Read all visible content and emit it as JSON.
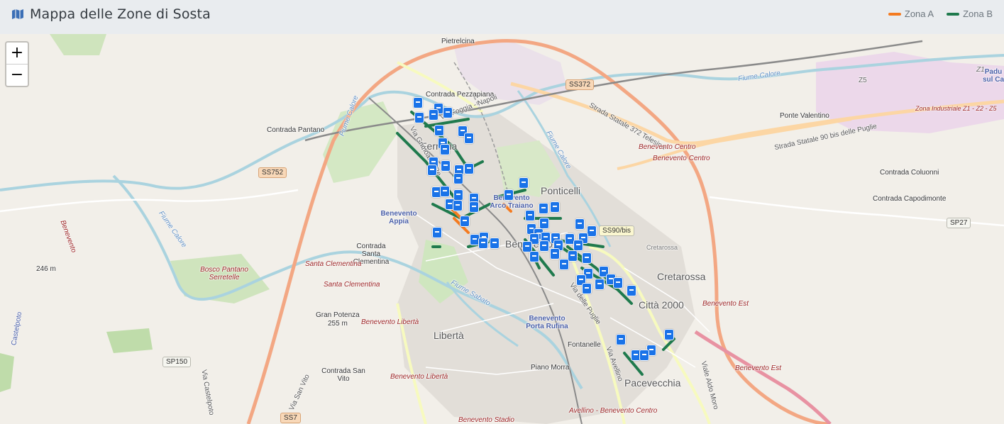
{
  "header": {
    "title": "Mappa delle Zone di Sosta",
    "icon": "map-icon"
  },
  "legend": [
    {
      "label": "Zona A",
      "color": "#f47b20"
    },
    {
      "label": "Zona B",
      "color": "#1f7a4d"
    }
  ],
  "zoom": {
    "in_label": "+",
    "out_label": "−"
  },
  "map": {
    "places": {
      "pietrelcina": "Pietrelcina",
      "contrada_pezzapiana": "Contrada Pezzapiana",
      "contrada_pantano": "Contrada Pantano",
      "ferrovia": "Ferrovia",
      "ponticelli": "Ponticelli",
      "benevento": "Benevento",
      "rione_libert": "Libertà",
      "cretarossa": "Cretarossa",
      "citta_2000": "Città 2000",
      "pacevecchia": "Pacevecchia",
      "ponte_valentino": "Ponte Valentino",
      "contrada_coluonni": "Contrada Coluonni",
      "contrada_capodimonte": "Contrada Capodimonte",
      "contrada_santa_clementina": "Contrada Santa Clementina",
      "contrada_san_vito": "Contrada San Vito",
      "gran_potenza": "Gran Potenza",
      "gran_potenza_elev": "255 m",
      "elev_246": "246 m",
      "bosco_pantano": "Bosco Pantano Serretelle",
      "fontanelle": "Fontanelle",
      "piano_morra": "Piano Morra",
      "cretarossa_small": "Cretarossa",
      "z5": "Z5",
      "z1": "Z1",
      "padu": "Padu sul Ca",
      "via_grimoaldo": "Via Grimoaldo Re",
      "via_puglie": "Via delle Puglie",
      "via_avellino": "Via Avellino",
      "via_aldo_moro": "Viale Aldo Moro",
      "via_san_vito": "Via San Vito",
      "via_castelpoto": "Via Castelpoto",
      "castelpoto": "Castelpoto",
      "benevento_label": "Benevento",
      "fiume_calore_1": "Fiume Calore",
      "fiume_calore_2": "Fiume Calore",
      "fiume_calore_3": "Fiume Calore",
      "fiume_calore_4": "Fiume Calore",
      "fiume_sabato": "Fiume Sabato",
      "via_foggia_napoli": "Via Foggia - Napoli",
      "strada_372": "Strada Statale 372 Telesina",
      "strada_90bis": "Strada Statale 90 bis delle Puglie",
      "zona_industriale": "Zona Industriale Z1 - Z2 - Z5"
    },
    "stations": {
      "appia": "Benevento Appia",
      "arco_traiano": "Benevento Arco Traiano",
      "porta_rufina": "Benevento Porta Rufina"
    },
    "rail_labels": {
      "benevento_centro_1": "Benevento Centro",
      "benevento_centro_2": "Benevento Centro",
      "santa_clementina_1": "Santa Clementina",
      "santa_clementina_2": "Santa Clementina",
      "benevento_liberta_1": "Benevento Libertà",
      "benevento_liberta_2": "Benevento Libertà",
      "benevento_est_1": "Benevento Est",
      "benevento_est_2": "Benevento Est",
      "avellino_benevento": "Avellino - Benevento Centro",
      "benevento_stadio": "Benevento Stadio"
    },
    "roads": {
      "ss372": "SS372",
      "ss752": "SS752",
      "ss90bis": "SS90/bis",
      "sp27": "SP27",
      "sp150": "SP150",
      "ss7": "SS7"
    }
  }
}
